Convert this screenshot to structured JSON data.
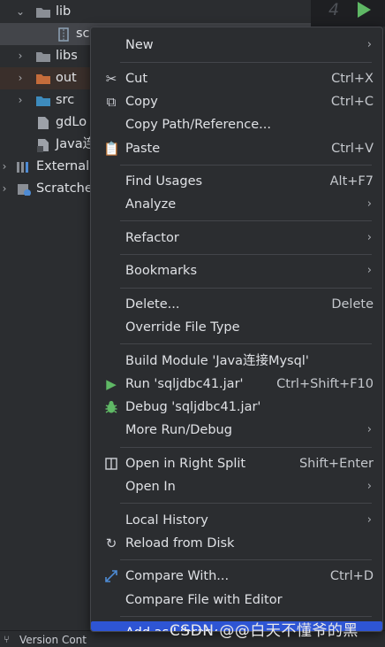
{
  "tree": {
    "items": [
      {
        "label": "lib"
      },
      {
        "label": "sc"
      },
      {
        "label": "libs"
      },
      {
        "label": "out"
      },
      {
        "label": "src"
      },
      {
        "label": "gdLo"
      },
      {
        "label": "Java连"
      },
      {
        "label": "External"
      },
      {
        "label": "Scratche"
      }
    ]
  },
  "editor": {
    "tab_count": "4"
  },
  "status": {
    "version_control": "Version Cont"
  },
  "menu": {
    "items": [
      {
        "label": "New",
        "shortcut": "",
        "submenu": true
      },
      {
        "label": "Cut",
        "shortcut": "Ctrl+X"
      },
      {
        "label": "Copy",
        "shortcut": "Ctrl+C"
      },
      {
        "label": "Copy Path/Reference...",
        "shortcut": ""
      },
      {
        "label": "Paste",
        "shortcut": "Ctrl+V"
      },
      {
        "label": "Find Usages",
        "shortcut": "Alt+F7"
      },
      {
        "label": "Analyze",
        "shortcut": "",
        "submenu": true
      },
      {
        "label": "Refactor",
        "shortcut": "",
        "submenu": true
      },
      {
        "label": "Bookmarks",
        "shortcut": "",
        "submenu": true
      },
      {
        "label": "Delete...",
        "shortcut": "Delete"
      },
      {
        "label": "Override File Type",
        "shortcut": ""
      },
      {
        "label": "Build Module 'Java连接Mysql'",
        "shortcut": ""
      },
      {
        "label": "Run 'sqljdbc41.jar'",
        "shortcut": "Ctrl+Shift+F10"
      },
      {
        "label": "Debug 'sqljdbc41.jar'",
        "shortcut": ""
      },
      {
        "label": "More Run/Debug",
        "shortcut": "",
        "submenu": true
      },
      {
        "label": "Open in Right Split",
        "shortcut": "Shift+Enter"
      },
      {
        "label": "Open In",
        "shortcut": "",
        "submenu": true
      },
      {
        "label": "Local History",
        "shortcut": "",
        "submenu": true
      },
      {
        "label": "Reload from Disk",
        "shortcut": ""
      },
      {
        "label": "Compare With...",
        "shortcut": "Ctrl+D"
      },
      {
        "label": "Compare File with Editor",
        "shortcut": ""
      },
      {
        "label": "Add as Library...",
        "shortcut": ""
      }
    ]
  },
  "watermark": "CSDN @@白天不懂爷的黑",
  "colors": {
    "menu_bg": "#2b2d30",
    "selection": "#2e55d4",
    "run_green": "#5fb865",
    "folder_orange": "#c46c3b",
    "folder_blue": "#3d8bbd"
  }
}
